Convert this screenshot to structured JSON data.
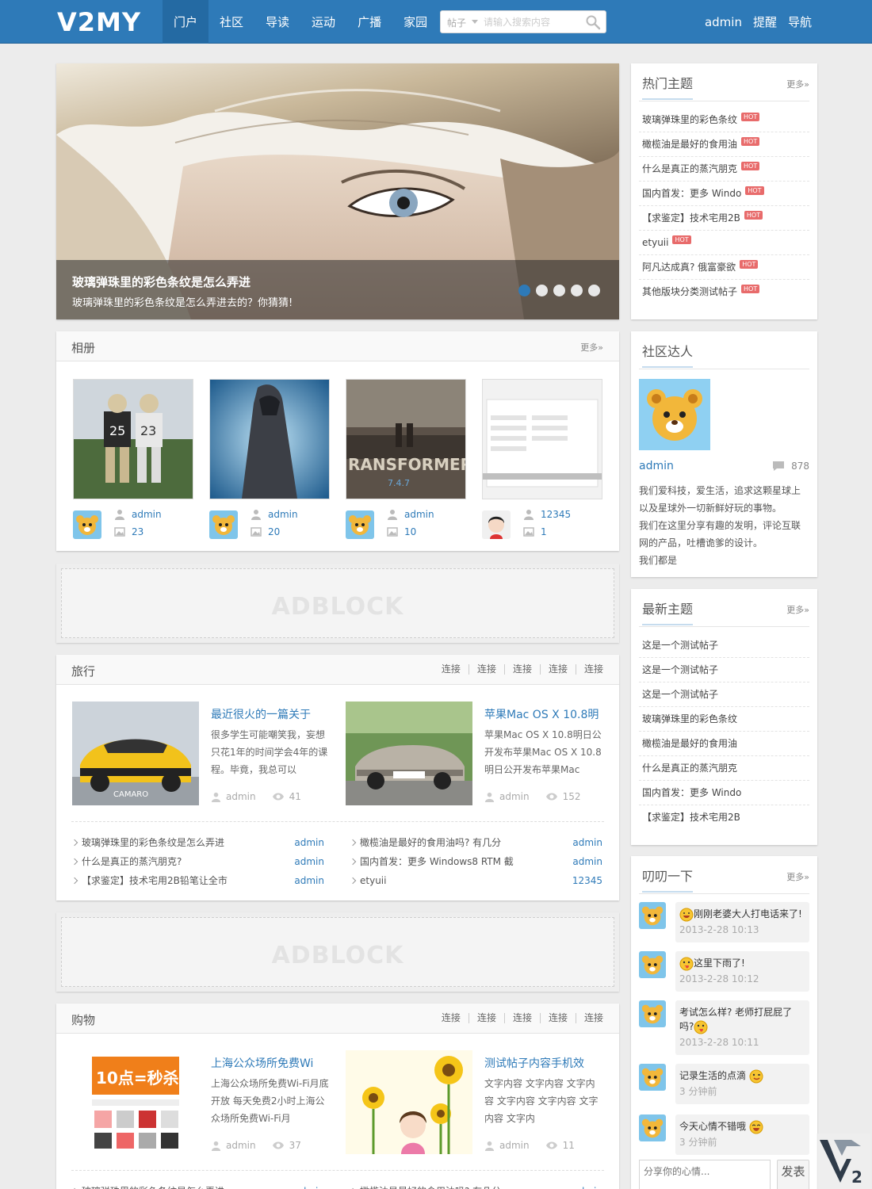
{
  "site": {
    "logo": "V2MY"
  },
  "nav": [
    {
      "label": "门户",
      "active": true
    },
    {
      "label": "社区"
    },
    {
      "label": "导读"
    },
    {
      "label": "运动"
    },
    {
      "label": "广播"
    },
    {
      "label": "家园"
    }
  ],
  "search": {
    "type": "帖子",
    "placeholder": "请输入搜索内容"
  },
  "user": {
    "name": "admin",
    "remind": "提醒",
    "guide": "导航"
  },
  "slider": {
    "title": "玻璃弹珠里的彩色条纹是怎么弄进",
    "desc": "玻璃弹珠里的彩色条纹是怎么弄进去的？你猜猜!",
    "active_dot": 1,
    "dot_count": 5
  },
  "album": {
    "title": "相册",
    "more": "更多»",
    "items": [
      {
        "author": "admin",
        "count": "23"
      },
      {
        "author": "admin",
        "count": "20"
      },
      {
        "author": "admin",
        "count": "10"
      },
      {
        "author": "12345",
        "count": "1"
      }
    ]
  },
  "ad": {
    "text": "ADBLOCK"
  },
  "travel": {
    "title": "旅行",
    "links": [
      "连接",
      "连接",
      "连接",
      "连接",
      "连接"
    ],
    "articles": [
      {
        "title": "最近很火的一篇关于",
        "desc": "很多学生可能嘲笑我，妄想只花1年的时间学会4年的课程。毕竟，我总可以",
        "author": "admin",
        "views": "41"
      },
      {
        "title": "苹果Mac OS X 10.8明",
        "desc": "苹果Mac OS X 10.8明日公开发布苹果Mac OS X 10.8明日公开发布苹果Mac",
        "author": "admin",
        "views": "152"
      }
    ],
    "list_left": [
      {
        "t": "玻璃弹珠里的彩色条纹是怎么弄进",
        "a": "admin"
      },
      {
        "t": "什么是真正的蒸汽朋克?",
        "a": "admin"
      },
      {
        "t": "【求鉴定】技术宅用2B铅笔让全市",
        "a": "admin"
      }
    ],
    "list_right": [
      {
        "t": "橄榄油是最好的食用油吗? 有几分",
        "a": "admin"
      },
      {
        "t": "国内首发：更多 Windows8 RTM 截",
        "a": "admin"
      },
      {
        "t": "etyuii",
        "a": "12345"
      }
    ]
  },
  "shopping": {
    "title": "购物",
    "links": [
      "连接",
      "连接",
      "连接",
      "连接",
      "连接"
    ],
    "articles": [
      {
        "title": "上海公众场所免费Wi",
        "desc": "上海公众场所免费Wi-Fi月底开放 每天免费2小时上海公众场所免费Wi-Fi月",
        "author": "admin",
        "views": "37",
        "img_text": "10点=秒杀"
      },
      {
        "title": "测试帖子内容手机效",
        "desc": "文字内容 文字内容 文字内容 文字内容 文字内容 文字内容 文字内",
        "author": "admin",
        "views": "11"
      }
    ],
    "list_left": [
      {
        "t": "玻璃弹珠里的彩色条纹是怎么弄进",
        "a": "admin"
      }
    ],
    "list_right": [
      {
        "t": "橄榄油是最好的食用油吗? 有几分",
        "a": "admin"
      }
    ]
  },
  "hot": {
    "title": "热门主题",
    "more": "更多»",
    "badge": "HOT",
    "items": [
      "玻璃弹珠里的彩色条纹",
      "橄榄油是最好的食用油",
      "什么是真正的蒸汽朋克",
      "国内首发：更多 Windo",
      "【求鉴定】技术宅用2B",
      "etyuii",
      "阿凡达成真? 俄富豪欲",
      "其他版块分类测试帖子"
    ]
  },
  "talent": {
    "title": "社区达人",
    "name": "admin",
    "count": "878",
    "bio": [
      "我们爱科技，爱生活，追求这颗星球上",
      "以及星球外一切新鲜好玩的事物。",
      "我们在这里分享有趣的发明，评论互联",
      "网的产品，吐槽诡爹的设计。",
      "我们都是"
    ]
  },
  "latest": {
    "title": "最新主题",
    "more": "更多»",
    "items": [
      "这是一个测试帖子",
      "这是一个测试帖子",
      "这是一个测试帖子",
      "玻璃弹珠里的彩色条纹",
      "橄榄油是最好的食用油",
      "什么是真正的蒸汽朋克",
      "国内首发：更多 Windo",
      "【求鉴定】技术宅用2B"
    ]
  },
  "feed": {
    "title": "叨叨一下",
    "more": "更多»",
    "items": [
      {
        "msg": "刚刚老婆大人打电话来了!",
        "time": "2013-2-28 10:13"
      },
      {
        "msg": "这里下雨了!",
        "time": "2013-2-28 10:12"
      },
      {
        "msg": "考试怎么样? 老师打屁屁了吗?",
        "time": "2013-2-28 10:11"
      },
      {
        "msg": "记录生活的点滴",
        "time": "3 分钟前"
      },
      {
        "msg": "今天心情不错哦",
        "time": "3 分钟前"
      }
    ],
    "placeholder": "分享你的心情...",
    "submit": "发表"
  },
  "colors": {
    "brand": "#2e7ab8",
    "hot": "#e86b6b",
    "background": "#ececec"
  }
}
